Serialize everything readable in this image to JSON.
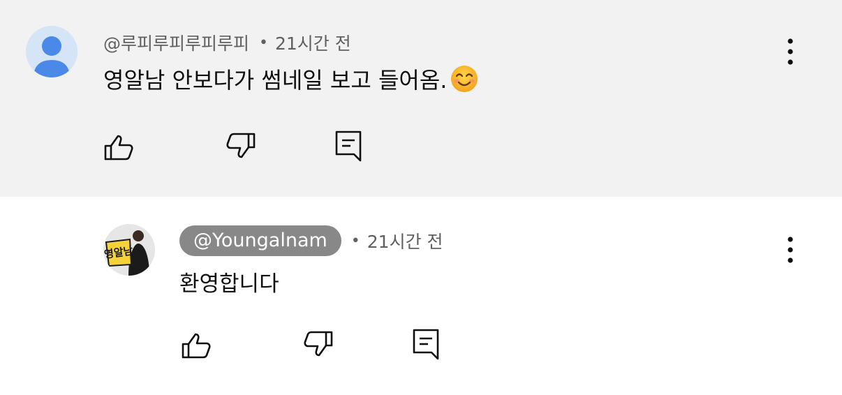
{
  "comments": [
    {
      "handle": "@루피루피루피루피",
      "separator": "•",
      "time": "21시간 전",
      "text": "영알남 안보다가 썸네일 보고 들어옴.",
      "emoji": "smiling-face-icon",
      "avatar": "default-person-avatar",
      "actions": [
        "like",
        "dislike",
        "reply"
      ]
    },
    {
      "handle": "@Youngalnam",
      "separator": "•",
      "time": "21시간 전",
      "text": "환영합니다",
      "avatar_text": "영알남",
      "is_creator": true,
      "actions": [
        "like",
        "dislike",
        "reply"
      ]
    }
  ],
  "colors": {
    "highlight_bg": "#f2f2f2",
    "secondary_text": "#606060",
    "primary_text": "#0f0f0f",
    "creator_chip": "#888888",
    "avatar_blue": "#4a89e8"
  }
}
